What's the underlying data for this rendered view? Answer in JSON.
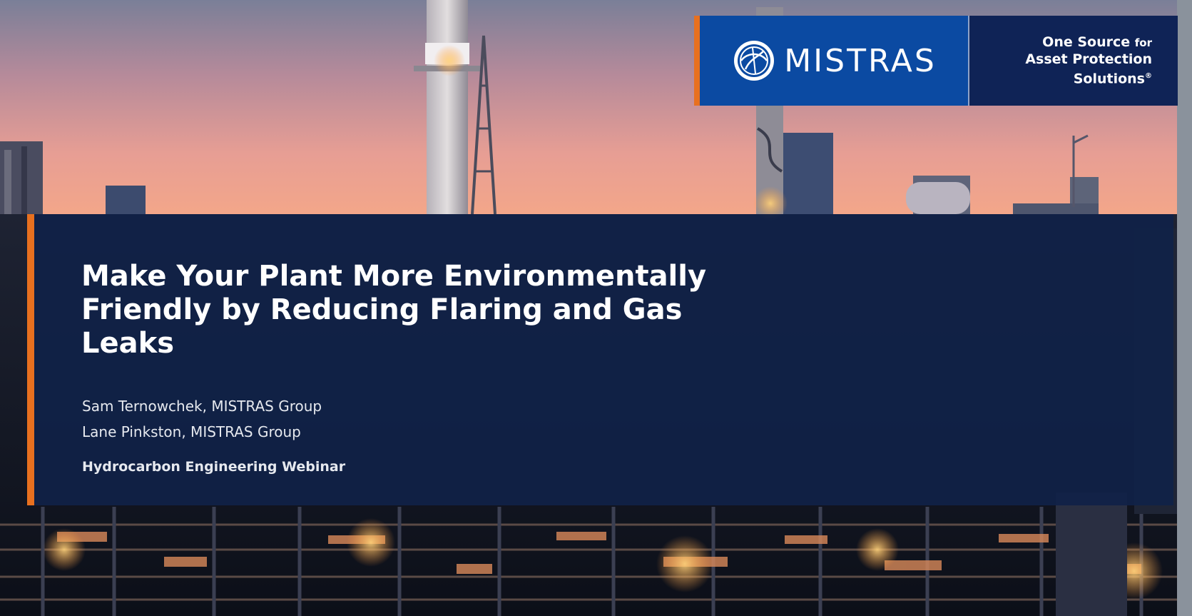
{
  "logo": {
    "brand": "MISTRAS",
    "tagline_line1_main": "One Source",
    "tagline_line1_small": "for",
    "tagline_line2": "Asset Protection",
    "tagline_line3": "Solutions",
    "tagline_mark": "®"
  },
  "title": {
    "text": "Make Your Plant More Environmentally Friendly by Reducing Flaring and Gas Leaks"
  },
  "presenters": [
    "Sam Ternowchek, MISTRAS Group",
    "Lane Pinkston, MISTRAS Group"
  ],
  "event": "Hydrocarbon Engineering Webinar",
  "colors": {
    "accent_orange": "#e8701f",
    "brand_blue": "#0b4aa2",
    "brand_navy": "#0f2356",
    "panel_navy": "#102248"
  },
  "icons": {
    "logo_mark": "mistras-globe-logo-icon"
  }
}
